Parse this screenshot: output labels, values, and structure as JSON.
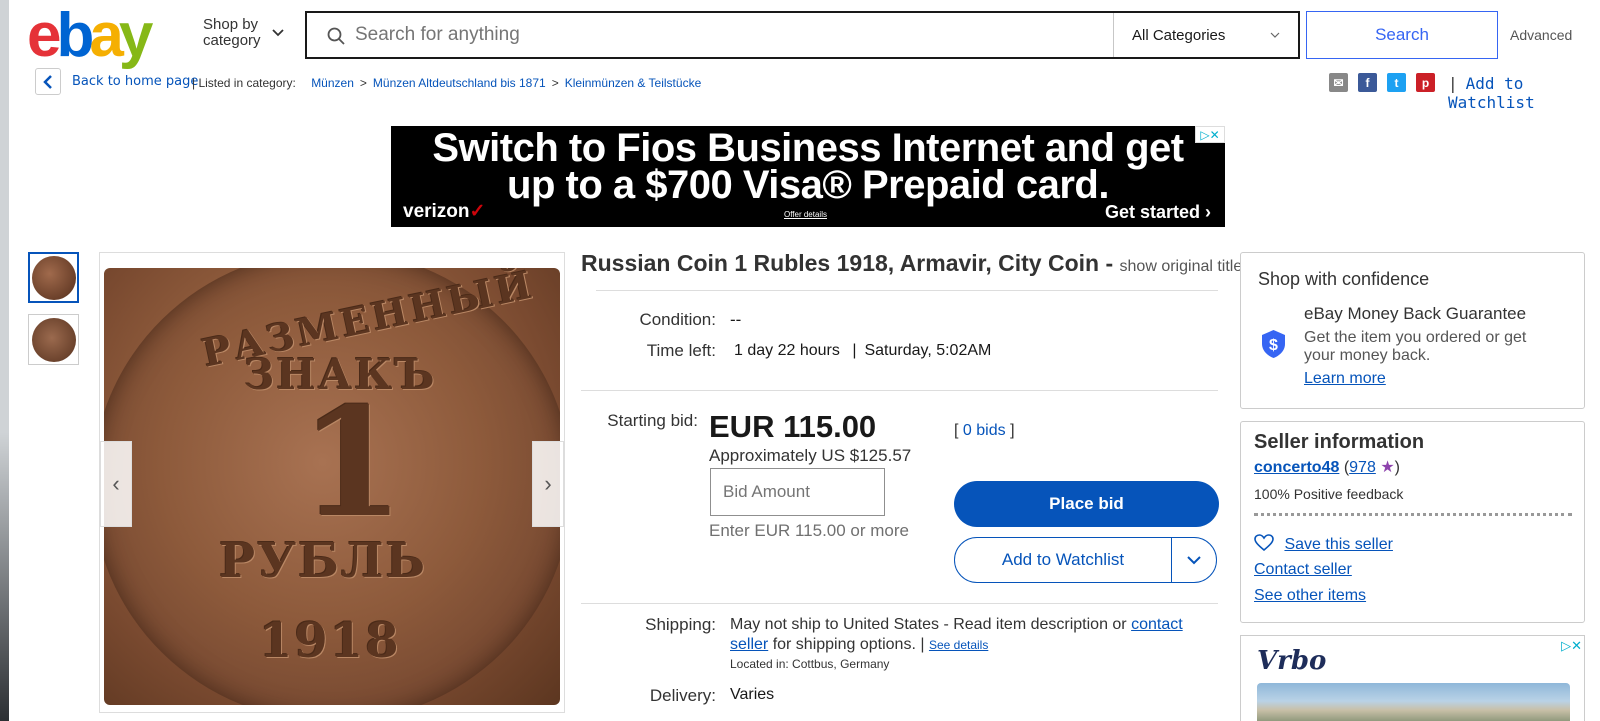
{
  "header": {
    "logo_letters": [
      "e",
      "b",
      "a",
      "y"
    ],
    "shop_by_line1": "Shop by",
    "shop_by_line2": "category",
    "search_placeholder": "Search for anything",
    "category_selected": "All Categories",
    "search_button": "Search",
    "advanced": "Advanced"
  },
  "breadcrumb": {
    "back": "Back to home page",
    "listed_in": "| Listed in category:",
    "items": [
      "Münzen",
      "Münzen Altdeutschland bis 1871",
      "Kleinmünzen & Teilstücke"
    ],
    "separator": ">",
    "share_icons": [
      "email-icon",
      "facebook-icon",
      "twitter-icon",
      "pinterest-icon"
    ],
    "divider": "|",
    "watchlist": "Add to Watchlist"
  },
  "ad_banner": {
    "headline_line1": "Switch to Fios Business Internet and get",
    "headline_line2": "up to a $700 Visa® Prepaid card.",
    "brand": "verizon",
    "offer": "Offer details",
    "cta": "Get started",
    "ad_choices": "▷✕"
  },
  "coin_image": {
    "top_text": "РАЗМЕННЫЙ",
    "word": "ЗНАКЪ",
    "denomination": "1",
    "unit": "РУБЛЬ",
    "year": "1918"
  },
  "item": {
    "title": "Russian Coin 1 Rubles 1918, Armavir, City Coin -",
    "show_original": "show original title",
    "condition_label": "Condition:",
    "condition_value": "--",
    "time_left_label": "Time left:",
    "time_left_value": "1 day 22 hours",
    "time_sep": "|",
    "end_time": "Saturday, 5:02AM",
    "starting_bid_label": "Starting bid:",
    "price": "EUR 115.00",
    "approx": "Approximately US $125.57",
    "bids_open": "[",
    "bids_link": "0 bids",
    "bids_close": "]",
    "bid_placeholder": "Bid Amount",
    "enter_hint": "Enter EUR 115.00 or more",
    "place_bid": "Place bid",
    "add_watchlist": "Add to Watchlist",
    "shipping_label": "Shipping:",
    "shipping_text": "May not ship to United States - Read item description or",
    "contact_link_1": "contact",
    "contact_link_2": "seller",
    "shipping_suffix": "for shipping options. |",
    "see_details": "See details",
    "located": "Located in:  Cottbus, Germany",
    "delivery_label": "Delivery:",
    "delivery_value": "Varies"
  },
  "confidence": {
    "title": "Shop with confidence",
    "guarantee_title": "eBay Money Back Guarantee",
    "guarantee_line1": "Get the item you ordered or get",
    "guarantee_line2": "your money back.",
    "learn_more": "Learn more"
  },
  "seller": {
    "title": "Seller information",
    "name": "concerto48",
    "open_paren": "(",
    "feedback_count": "978",
    "close_paren": ")",
    "positive": "100% Positive feedback",
    "save": "Save this seller",
    "contact": "Contact seller",
    "other_items": "See other items"
  },
  "side_ad": {
    "brand": "Vrbo",
    "ad_choices": "▷✕"
  },
  "colors": {
    "link": "#0654ba",
    "primary_button": "#0654ba",
    "search_border": "#3665f3",
    "ad_background": "#000000"
  }
}
